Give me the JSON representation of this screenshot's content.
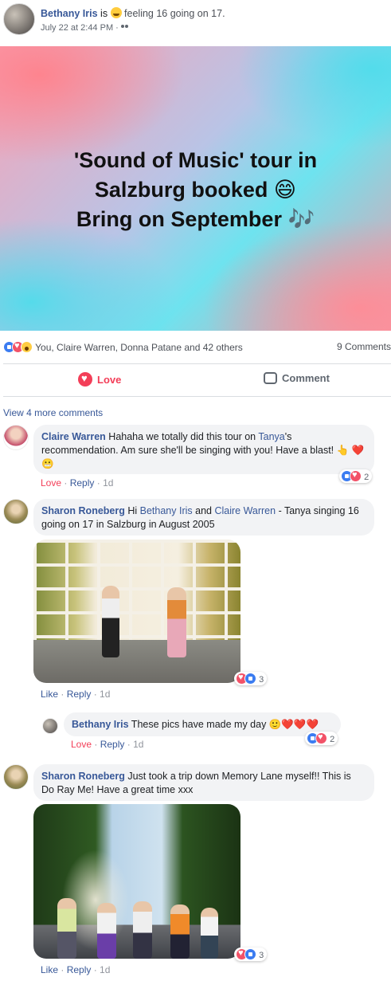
{
  "post": {
    "author": "Bethany Iris",
    "is_text": "is",
    "feeling": "feeling 16 going on 17.",
    "timestamp": "July 22 at 2:44 PM ·",
    "banner_lines": [
      "'Sound of Music' tour in",
      "Salzburg booked 😄",
      "Bring on September 🎶"
    ],
    "reactions_summary": "You, Claire Warren, Donna Patane and 42 others",
    "comments_count": "9 Comments",
    "love_label": "Love",
    "comment_label": "Comment",
    "view_more": "View 4 more comments"
  },
  "comments": [
    {
      "author": "Claire Warren",
      "text_1": " Hahaha we totally did this tour on ",
      "mention": "Tanya",
      "text_2": "'s recommendation. Am sure she'll be singing with you! Have a blast! 👆 ❤️😬",
      "action_love": "Love",
      "action_reply": "Reply",
      "time": "1d",
      "reaction_count": "2"
    },
    {
      "author": "Sharon Roneberg",
      "text_1": " Hi ",
      "mention_1": "Bethany Iris",
      "text_2": " and ",
      "mention_2": "Claire Warren",
      "text_3": " - Tanya singing 16 going on 17 in Salzburg in August 2005",
      "action_like": "Like",
      "action_reply": "Reply",
      "time": "1d",
      "reaction_count": "3"
    },
    {
      "author": "Bethany Iris",
      "text": " These pics have made my day 🙂❤️❤️❤️",
      "action_love": "Love",
      "action_reply": "Reply",
      "time": "1d",
      "reaction_count": "2"
    },
    {
      "author": "Sharon Roneberg",
      "text": " Just took a trip down Memory Lane myself!! This is Do Ray Me! Have a great time xxx",
      "action_like": "Like",
      "action_reply": "Reply",
      "time": "1d",
      "reaction_count": "3"
    }
  ],
  "colors": {
    "link": "#385898",
    "love": "#f33e58",
    "like": "#3b7cf1"
  }
}
